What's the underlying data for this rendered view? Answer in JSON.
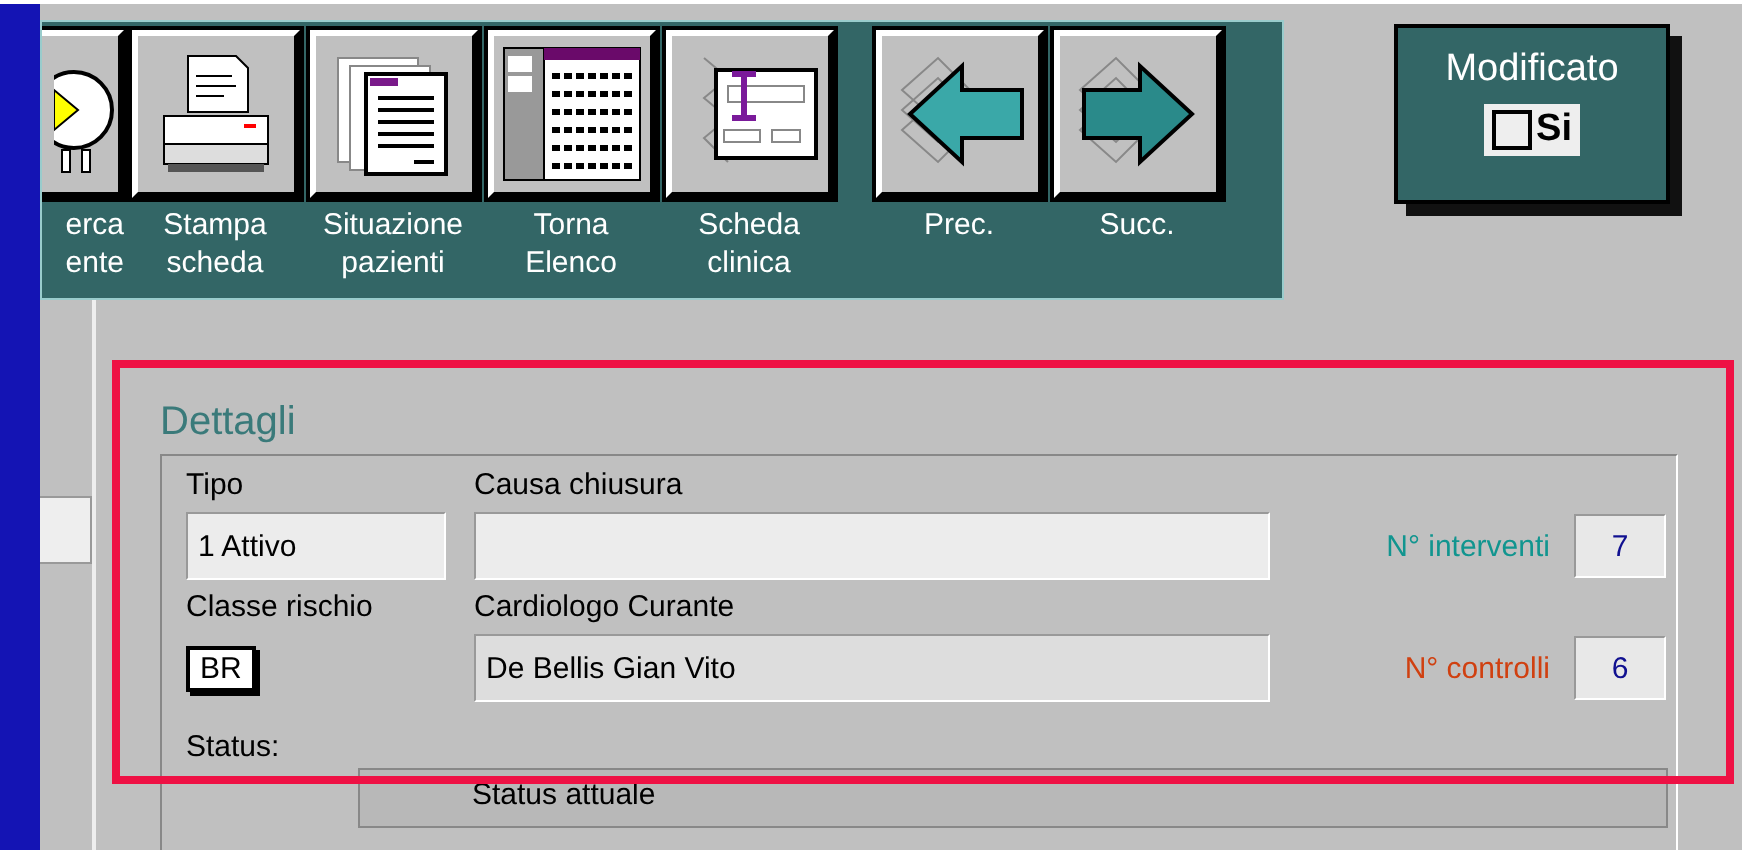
{
  "toolbar": {
    "buttons": [
      {
        "kind": "search",
        "lines": [
          "erca",
          "ente"
        ]
      },
      {
        "kind": "print",
        "lines": [
          "Stampa",
          "scheda"
        ]
      },
      {
        "kind": "pages",
        "lines": [
          "Situazione",
          "pazienti"
        ]
      },
      {
        "kind": "list",
        "lines": [
          "Torna",
          "Elenco"
        ]
      },
      {
        "kind": "form",
        "lines": [
          "Scheda",
          "clinica"
        ]
      },
      {
        "kind": "prev",
        "lines": [
          "Prec."
        ]
      },
      {
        "kind": "next",
        "lines": [
          "Succ."
        ]
      }
    ]
  },
  "modified": {
    "label": "Modificato",
    "checkbox": {
      "label": "Si",
      "checked": false
    }
  },
  "details": {
    "title": "Dettagli",
    "tipo": {
      "label": "Tipo",
      "value": "1 Attivo"
    },
    "causa": {
      "label": "Causa chiusura"
    },
    "interventi": {
      "label": "N° interventi",
      "value": "7"
    },
    "classe": {
      "label": "Classe rischio",
      "value": "BR"
    },
    "cardiologo": {
      "label": "Cardiologo Curante",
      "value": "De Bellis  Gian Vito"
    },
    "controlli": {
      "label": "N° controlli",
      "value": "6"
    },
    "status": {
      "label": "Status:",
      "header": "Status attuale"
    }
  }
}
